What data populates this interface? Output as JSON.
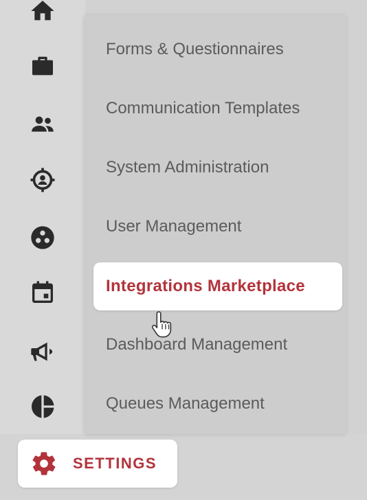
{
  "sidebar": {
    "icons": [
      {
        "name": "home-icon"
      },
      {
        "name": "briefcase-icon"
      },
      {
        "name": "people-icon"
      },
      {
        "name": "target-person-icon"
      },
      {
        "name": "apps-circle-icon"
      },
      {
        "name": "calendar-icon"
      },
      {
        "name": "megaphone-icon"
      },
      {
        "name": "pie-chart-icon"
      }
    ],
    "settings": {
      "label": "SETTINGS",
      "icon": "gear-icon"
    }
  },
  "submenu": {
    "items": [
      {
        "label": "Forms & Questionnaires"
      },
      {
        "label": "Communication Templates"
      },
      {
        "label": "System Administration"
      },
      {
        "label": "User Management"
      },
      {
        "label": "Integrations Marketplace",
        "active": true
      },
      {
        "label": "Dashboard Management"
      },
      {
        "label": "Queues Management"
      }
    ]
  },
  "colors": {
    "accent": "#b2333b",
    "icon": "#2a2a2a",
    "text": "#5b5b5b"
  },
  "cursor": "hand-pointer-icon"
}
